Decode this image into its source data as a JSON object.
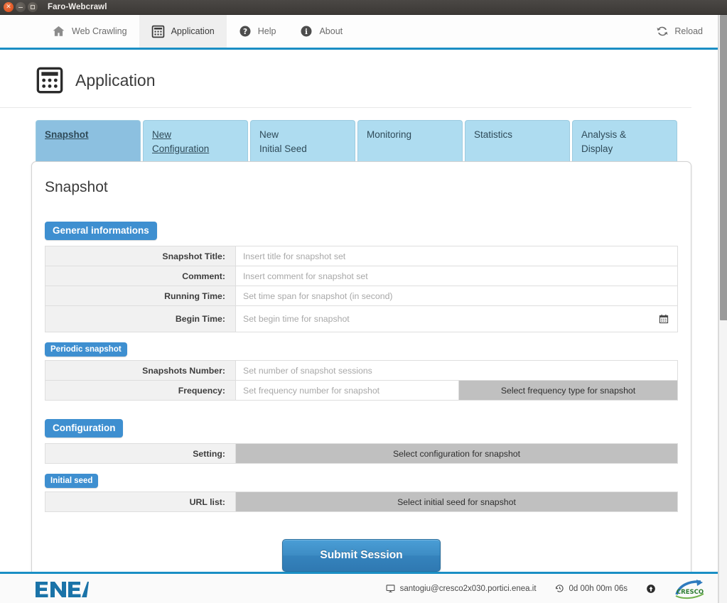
{
  "window": {
    "title": "Faro-Webcrawl",
    "controls": [
      "close",
      "minimize",
      "maximize"
    ]
  },
  "topnav": {
    "items": [
      {
        "label": "Web Crawling",
        "icon": "home-icon",
        "active": false
      },
      {
        "label": "Application",
        "icon": "calculator-grid-icon",
        "active": true
      },
      {
        "label": "Help",
        "icon": "question-circle-icon",
        "active": false
      },
      {
        "label": "About",
        "icon": "info-circle-icon",
        "active": false
      }
    ],
    "reload": {
      "label": "Reload",
      "icon": "reload-icon"
    }
  },
  "page": {
    "title": "Application",
    "icon": "calculator-grid-icon"
  },
  "tabs": [
    {
      "label": "Snapshot",
      "state": "active"
    },
    {
      "label": "New Configuration",
      "line1": "New",
      "line2": "Configuration",
      "state": "hover"
    },
    {
      "label": "New Initial Seed",
      "line1": "New",
      "line2": "Initial Seed",
      "state": "normal"
    },
    {
      "label": "Monitoring",
      "line1": "Monitoring",
      "line2": "",
      "state": "normal"
    },
    {
      "label": "Statistics",
      "line1": "Statistics",
      "line2": "",
      "state": "normal"
    },
    {
      "label": "Analysis & Display",
      "line1": "Analysis &",
      "line2": "Display",
      "state": "normal"
    }
  ],
  "panel": {
    "heading": "Snapshot",
    "sections": {
      "general": {
        "badge": "General informations",
        "fields": [
          {
            "label": "Snapshot Title:",
            "placeholder": "Insert title for snapshot set",
            "value": ""
          },
          {
            "label": "Comment:",
            "placeholder": "Insert comment for snapshot set",
            "value": ""
          },
          {
            "label": "Running Time:",
            "placeholder": "Set time span for snapshot (in second)",
            "value": ""
          },
          {
            "label": "Begin Time:",
            "placeholder": "Set begin time for snapshot",
            "value": "",
            "icon": "calendar-icon"
          }
        ]
      },
      "periodic": {
        "badge": "Periodic snapshot",
        "fields": [
          {
            "label": "Snapshots Number:",
            "placeholder": "Set number of snapshot sessions",
            "value": ""
          },
          {
            "label": "Frequency:",
            "placeholder": "Set frequency number for snapshot",
            "value": "",
            "select": "Select frequency type for snapshot"
          }
        ]
      },
      "configuration": {
        "badge": "Configuration",
        "fields": [
          {
            "label": "Setting:",
            "select": "Select configuration for snapshot"
          }
        ]
      },
      "initial_seed": {
        "badge": "Initial seed",
        "fields": [
          {
            "label": "URL list:",
            "select": "Select initial seed for snapshot"
          }
        ]
      }
    },
    "submit": "Submit Session"
  },
  "footer": {
    "logo": "ENEA",
    "host": "santogiu@cresco2x030.portici.enea.it",
    "host_icon": "monitor-icon",
    "uptime": "0d 00h 00m 06s",
    "uptime_icon": "clock-history-icon",
    "status_icon": "arrow-up-circle-icon",
    "partner_logo": "CRESCO"
  },
  "colors": {
    "accent_blue": "#1a8ec4",
    "badge_blue": "#3e8fd0",
    "tab_active": "#8cc0e0",
    "tab_normal": "#aedcf0",
    "select_gray": "#c0c0c0",
    "label_gray": "#f1f1f1",
    "enea_blue": "#1a73a8",
    "cresco_green": "#2e8b45",
    "submit_blue": "#3d8cc4"
  }
}
